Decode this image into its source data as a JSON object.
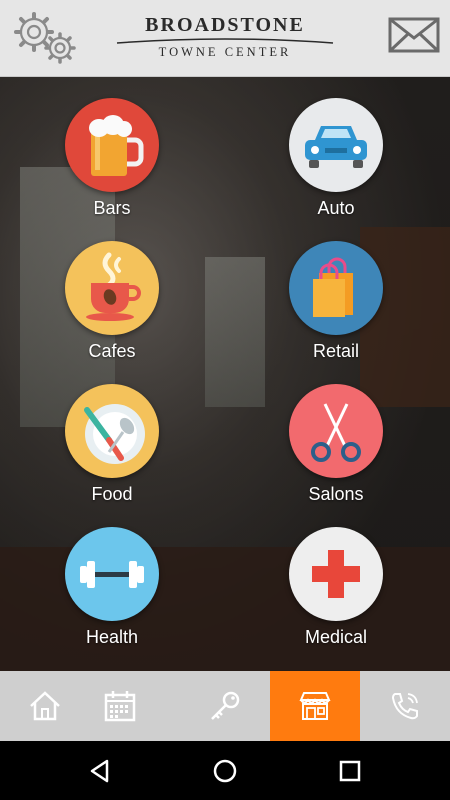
{
  "header": {
    "brand_line1": "BROADSTONE",
    "brand_line2": "TOWNE CENTER",
    "settings_icon": "gears-icon",
    "mail_icon": "envelope-icon"
  },
  "categories": [
    {
      "label": "Bars",
      "icon": "beer-mug-icon",
      "color": "#e0483a"
    },
    {
      "label": "Auto",
      "icon": "car-icon",
      "color": "#e8eaec"
    },
    {
      "label": "Cafes",
      "icon": "coffee-cup-icon",
      "color": "#f4c25b"
    },
    {
      "label": "Retail",
      "icon": "shopping-bag-icon",
      "color": "#3e86b8"
    },
    {
      "label": "Food",
      "icon": "plate-cutlery-icon",
      "color": "#f4c25b"
    },
    {
      "label": "Salons",
      "icon": "scissors-icon",
      "color": "#f26a6e"
    },
    {
      "label": "Health",
      "icon": "dumbbell-icon",
      "color": "#6cc6ec"
    },
    {
      "label": "Medical",
      "icon": "red-cross-icon",
      "color": "#eeeeee"
    }
  ],
  "tabbar": {
    "tabs": [
      {
        "icon": "home-icon"
      },
      {
        "icon": "calendar-icon"
      },
      {
        "icon": "key-icon"
      },
      {
        "icon": "storefront-icon",
        "active": true
      },
      {
        "icon": "phone-icon"
      }
    ],
    "active_color": "#ff7b0f"
  },
  "navbar": {
    "buttons": [
      "back-triangle-icon",
      "home-circle-icon",
      "recents-square-icon"
    ]
  }
}
